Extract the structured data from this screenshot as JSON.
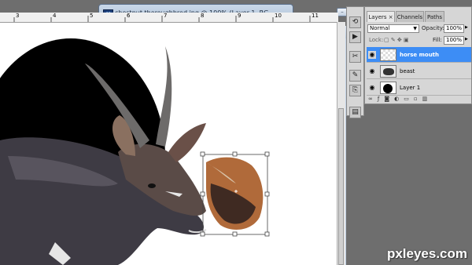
{
  "background_window": {
    "title": "chestnut thoroughbred.jpg @ 100% (Layer 1, RG...",
    "app_icon": "Fl"
  },
  "document_window": {
    "title": "",
    "ruler_numbers": [
      "3",
      "4",
      "5",
      "6",
      "7",
      "8",
      "9",
      "10",
      "11"
    ]
  },
  "layers_panel": {
    "tabs": [
      {
        "label": "Layers ×",
        "active": true
      },
      {
        "label": "Channels",
        "active": false
      },
      {
        "label": "Paths",
        "active": false
      }
    ],
    "blend_mode": "Normal",
    "opacity_label": "Opacity:",
    "opacity_value": "100%",
    "lock_label": "Lock:",
    "fill_label": "Fill:",
    "fill_value": "100%",
    "layers": [
      {
        "name": "horse mouth",
        "selected": true
      },
      {
        "name": "beast",
        "selected": false
      },
      {
        "name": "Layer 1",
        "selected": false
      }
    ],
    "footer_icons": [
      "link-icon",
      "fx-icon",
      "mask-icon",
      "adjustment-icon",
      "group-icon",
      "new-layer-icon",
      "trash-icon"
    ]
  },
  "tool_strip": {
    "icons": [
      "history-icon",
      "actions-icon",
      "tools-icon",
      "brush-icon",
      "clone-source-icon",
      "navigator-icon"
    ]
  },
  "watermark": "pxleyes.com",
  "colors": {
    "selection_blue": "#3d8df5",
    "window_blue": "#c3d3e6"
  }
}
